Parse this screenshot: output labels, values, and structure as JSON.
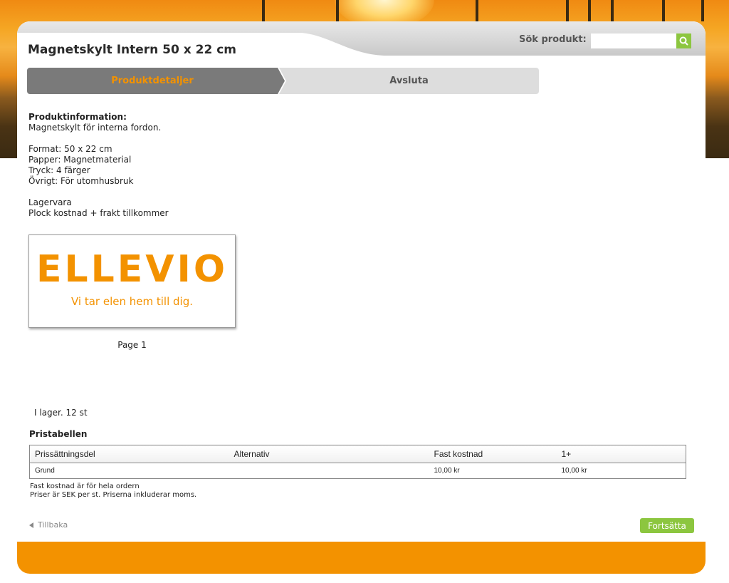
{
  "header": {
    "product_title": "Magnetskylt Intern 50 x 22 cm",
    "search_label": "Sök produkt:",
    "search_value": "",
    "search_icon": "search-icon"
  },
  "steps": {
    "active": "Produktdetaljer",
    "next": "Avsluta"
  },
  "product_info": {
    "heading": "Produktinformation:",
    "description": "Magnetskylt för interna fordon.",
    "format": "Format: 50 x 22 cm",
    "paper": "Papper: Magnetmaterial",
    "print": "Tryck: 4 färger",
    "other": "Övrigt: För utomhusbruk",
    "stock_item": "Lagervara",
    "pick_cost": "Plock kostnad + frakt tillkommer"
  },
  "preview": {
    "logo_text": "ELLEVIO",
    "tagline": "Vi tar elen hem till dig.",
    "page_label": "Page 1"
  },
  "stock": "I lager. 12 st",
  "price_table": {
    "heading": "Pristabellen",
    "columns": [
      "Prissättningsdel",
      "Alternativ",
      "Fast kostnad",
      "1+"
    ],
    "rows": [
      [
        "Grund",
        "",
        "10,00 kr",
        "10,00 kr"
      ]
    ],
    "note_1": "Fast kostnad är för hela ordern",
    "note_2": "Priser är SEK per st. Priserna inkluderar moms."
  },
  "actions": {
    "back_label": "Tillbaka",
    "continue_label": "Fortsätta"
  },
  "colors": {
    "brand_orange": "#f39200",
    "accent_green": "#8cc63f",
    "step_active_bg": "#7a7a7a",
    "step_inactive_bg": "#dddddd"
  }
}
